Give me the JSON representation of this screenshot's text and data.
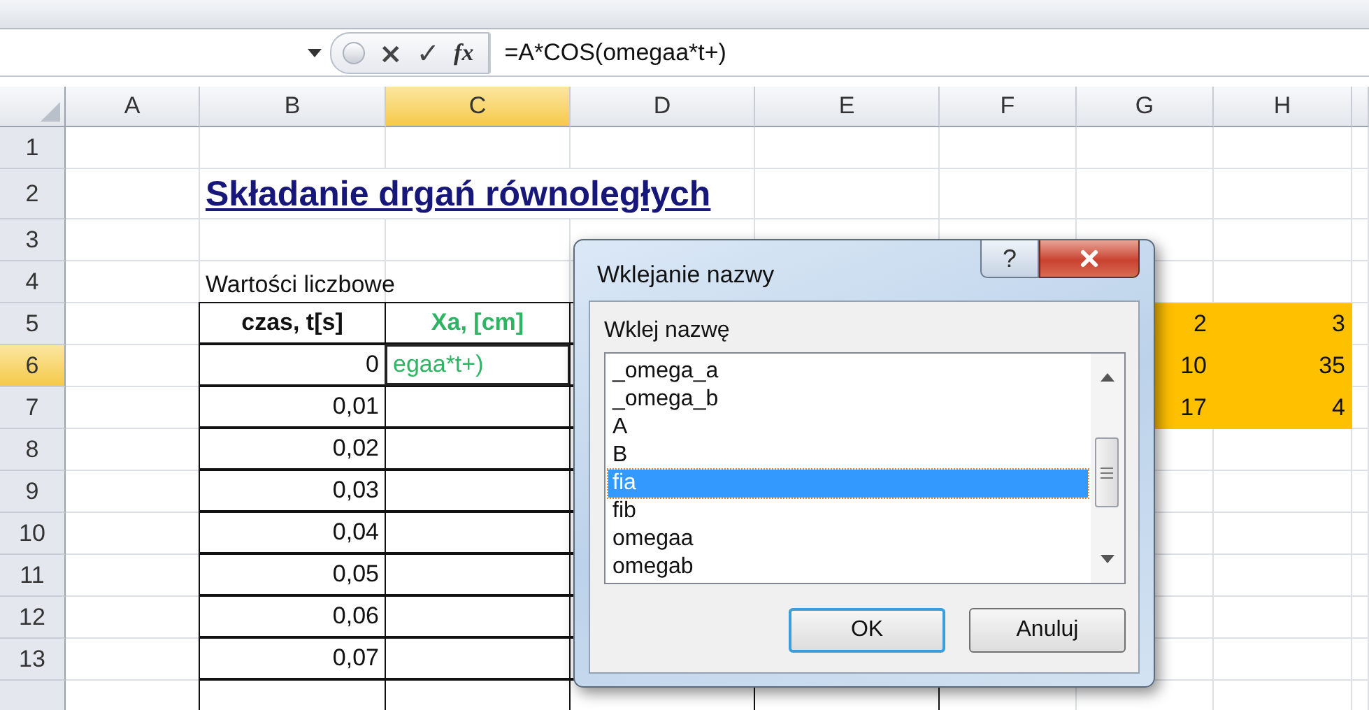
{
  "formula_bar": {
    "cancel": "×",
    "enter": "✓",
    "fx": "fx",
    "formula": "=A*COS(omegaa*t+)"
  },
  "columns": [
    {
      "label": "A",
      "selected": false
    },
    {
      "label": "B",
      "selected": false
    },
    {
      "label": "C",
      "selected": true
    },
    {
      "label": "D",
      "selected": false
    },
    {
      "label": "E",
      "selected": false
    },
    {
      "label": "F",
      "selected": false
    },
    {
      "label": "G",
      "selected": false
    },
    {
      "label": "H",
      "selected": false
    }
  ],
  "rows": [
    {
      "header": "1",
      "selected": false,
      "cells": [
        {
          "kind": "blank"
        },
        {
          "kind": "blank"
        },
        {
          "kind": "blank"
        },
        {
          "kind": "blank"
        },
        {
          "kind": "blank"
        },
        {
          "kind": "blank"
        },
        {
          "kind": "blank"
        },
        {
          "kind": "blank"
        }
      ]
    },
    {
      "header": "2",
      "selected": false,
      "cells": [
        {
          "kind": "blank"
        },
        {
          "kind": "title",
          "text": "Składanie drgań równoległych"
        },
        {
          "kind": "blank"
        },
        {
          "kind": "blank"
        },
        {
          "kind": "blank"
        },
        {
          "kind": "blank"
        }
      ]
    },
    {
      "header": "3",
      "selected": false,
      "cells": [
        {
          "kind": "blank"
        },
        {
          "kind": "blank"
        },
        {
          "kind": "blank"
        },
        {
          "kind": "blank"
        },
        {
          "kind": "blank"
        },
        {
          "kind": "blank"
        },
        {
          "kind": "blank"
        },
        {
          "kind": "blank"
        }
      ]
    },
    {
      "header": "4",
      "selected": false,
      "cells": [
        {
          "kind": "blank"
        },
        {
          "kind": "label",
          "text": "Wartości liczbowe"
        },
        {
          "kind": "blank"
        },
        {
          "kind": "covered"
        },
        {
          "kind": "covered"
        },
        {
          "kind": "covered"
        },
        {
          "kind": "blank"
        },
        {
          "kind": "blank"
        }
      ]
    },
    {
      "header": "5",
      "selected": false,
      "cells": [
        {
          "kind": "blank"
        },
        {
          "kind": "header",
          "text": "czas, t[s]"
        },
        {
          "kind": "green",
          "text": "Xa, [cm]"
        },
        {
          "kind": "boxed"
        },
        {
          "kind": "covered_boxed"
        },
        {
          "kind": "orange"
        },
        {
          "kind": "orange",
          "text": "2"
        },
        {
          "kind": "orange",
          "text": "3"
        }
      ]
    },
    {
      "header": "6",
      "selected": true,
      "cells": [
        {
          "kind": "blank"
        },
        {
          "kind": "number",
          "text": "0"
        },
        {
          "kind": "editing",
          "text": "egaa*t+)"
        },
        {
          "kind": "boxed"
        },
        {
          "kind": "boxed"
        },
        {
          "kind": "orange"
        },
        {
          "kind": "orange",
          "text": "10"
        },
        {
          "kind": "orange",
          "text": "35"
        }
      ]
    },
    {
      "header": "7",
      "selected": false,
      "cells": [
        {
          "kind": "blank"
        },
        {
          "kind": "number",
          "text": "0,01"
        },
        {
          "kind": "boxed"
        },
        {
          "kind": "boxed"
        },
        {
          "kind": "boxed"
        },
        {
          "kind": "orange"
        },
        {
          "kind": "orange",
          "text": "17"
        },
        {
          "kind": "orange",
          "text": "4"
        }
      ]
    },
    {
      "header": "8",
      "selected": false,
      "cells": [
        {
          "kind": "blank"
        },
        {
          "kind": "number",
          "text": "0,02"
        },
        {
          "kind": "boxed"
        },
        {
          "kind": "boxed"
        },
        {
          "kind": "boxed"
        },
        {
          "kind": "blank"
        },
        {
          "kind": "blank"
        },
        {
          "kind": "blank"
        }
      ]
    },
    {
      "header": "9",
      "selected": false,
      "cells": [
        {
          "kind": "blank"
        },
        {
          "kind": "number",
          "text": "0,03"
        },
        {
          "kind": "boxed"
        },
        {
          "kind": "boxed"
        },
        {
          "kind": "boxed"
        },
        {
          "kind": "blank"
        },
        {
          "kind": "blank"
        },
        {
          "kind": "blank"
        }
      ]
    },
    {
      "header": "10",
      "selected": false,
      "cells": [
        {
          "kind": "blank"
        },
        {
          "kind": "number",
          "text": "0,04"
        },
        {
          "kind": "boxed"
        },
        {
          "kind": "boxed"
        },
        {
          "kind": "boxed"
        },
        {
          "kind": "blank"
        },
        {
          "kind": "blank"
        },
        {
          "kind": "blank"
        }
      ]
    },
    {
      "header": "11",
      "selected": false,
      "cells": [
        {
          "kind": "blank"
        },
        {
          "kind": "number",
          "text": "0,05"
        },
        {
          "kind": "boxed"
        },
        {
          "kind": "boxed"
        },
        {
          "kind": "boxed"
        },
        {
          "kind": "blank"
        },
        {
          "kind": "blank"
        },
        {
          "kind": "blank"
        }
      ]
    },
    {
      "header": "12",
      "selected": false,
      "cells": [
        {
          "kind": "blank"
        },
        {
          "kind": "number",
          "text": "0,06"
        },
        {
          "kind": "boxed"
        },
        {
          "kind": "boxed"
        },
        {
          "kind": "boxed"
        },
        {
          "kind": "blank"
        },
        {
          "kind": "blank"
        },
        {
          "kind": "blank"
        }
      ]
    },
    {
      "header": "13",
      "selected": false,
      "cells": [
        {
          "kind": "blank"
        },
        {
          "kind": "number",
          "text": "0,07"
        },
        {
          "kind": "boxed"
        },
        {
          "kind": "boxed"
        },
        {
          "kind": "boxed"
        },
        {
          "kind": "blank"
        },
        {
          "kind": "blank"
        },
        {
          "kind": "blank"
        }
      ]
    },
    {
      "selected": false,
      "cells": [
        {
          "kind": "blank"
        },
        {
          "kind": "boxed"
        },
        {
          "kind": "boxed"
        },
        {
          "kind": "boxed"
        },
        {
          "kind": "boxed"
        },
        {
          "kind": "blank"
        },
        {
          "kind": "blank"
        },
        {
          "kind": "blank"
        }
      ]
    }
  ],
  "dialog": {
    "title": "Wklejanie nazwy",
    "help": "?",
    "label": "Wklej nazwę",
    "names": [
      {
        "label": "_omega_a",
        "selected": false
      },
      {
        "label": "_omega_b",
        "selected": false
      },
      {
        "label": "A",
        "selected": false
      },
      {
        "label": "B",
        "selected": false
      },
      {
        "label": "fia",
        "selected": true
      },
      {
        "label": "fib",
        "selected": false
      },
      {
        "label": "omegaa",
        "selected": false
      },
      {
        "label": "omegab",
        "selected": false
      }
    ],
    "buttons": [
      {
        "label": "OK",
        "default": true
      },
      {
        "label": "Anuluj",
        "default": false
      }
    ]
  }
}
